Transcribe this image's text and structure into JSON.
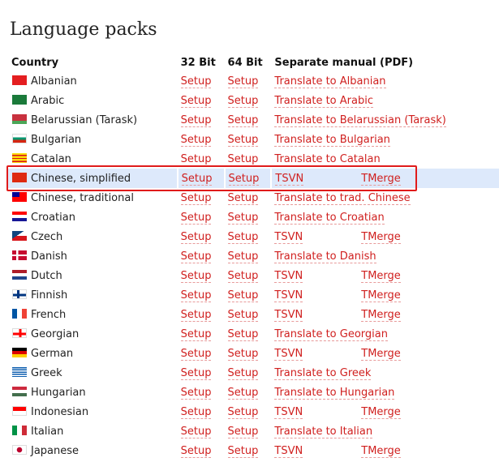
{
  "page": {
    "title": "Language packs"
  },
  "table": {
    "headers": {
      "country": "Country",
      "bit32": "32 Bit",
      "bit64": "64 Bit",
      "manual": "Separate manual (PDF)"
    },
    "rows": [
      {
        "country": "Albanian",
        "flag": "albania-flag-icon",
        "setup32": "Setup",
        "setup64": "Setup",
        "manual": "Translate to Albanian",
        "tmerge": ""
      },
      {
        "country": "Arabic",
        "flag": "saudi-arabia-flag-icon",
        "setup32": "Setup",
        "setup64": "Setup",
        "manual": "Translate to Arabic",
        "tmerge": ""
      },
      {
        "country": "Belarussian (Tarask)",
        "flag": "belarus-flag-icon",
        "setup32": "Setup",
        "setup64": "Setup",
        "manual": "Translate to Belarussian (Tarask)",
        "tmerge": ""
      },
      {
        "country": "Bulgarian",
        "flag": "bulgaria-flag-icon",
        "setup32": "Setup",
        "setup64": "Setup",
        "manual": "Translate to Bulgarian",
        "tmerge": ""
      },
      {
        "country": "Catalan",
        "flag": "catalonia-flag-icon",
        "setup32": "Setup",
        "setup64": "Setup",
        "manual": "Translate to Catalan",
        "tmerge": ""
      },
      {
        "country": "Chinese, simplified",
        "flag": "china-flag-icon",
        "setup32": "Setup",
        "setup64": "Setup",
        "manual": "TSVN",
        "tmerge": "TMerge",
        "highlighted": true
      },
      {
        "country": "Chinese, traditional",
        "flag": "taiwan-flag-icon",
        "setup32": "Setup",
        "setup64": "Setup",
        "manual": "Translate to trad. Chinese",
        "tmerge": ""
      },
      {
        "country": "Croatian",
        "flag": "croatia-flag-icon",
        "setup32": "Setup",
        "setup64": "Setup",
        "manual": "Translate to Croatian",
        "tmerge": ""
      },
      {
        "country": "Czech",
        "flag": "czech-flag-icon",
        "setup32": "Setup",
        "setup64": "Setup",
        "manual": "TSVN",
        "tmerge": "TMerge"
      },
      {
        "country": "Danish",
        "flag": "denmark-flag-icon",
        "setup32": "Setup",
        "setup64": "Setup",
        "manual": "Translate to Danish",
        "tmerge": ""
      },
      {
        "country": "Dutch",
        "flag": "netherlands-flag-icon",
        "setup32": "Setup",
        "setup64": "Setup",
        "manual": "TSVN",
        "tmerge": "TMerge"
      },
      {
        "country": "Finnish",
        "flag": "finland-flag-icon",
        "setup32": "Setup",
        "setup64": "Setup",
        "manual": "TSVN",
        "tmerge": "TMerge"
      },
      {
        "country": "French",
        "flag": "france-flag-icon",
        "setup32": "Setup",
        "setup64": "Setup",
        "manual": "TSVN",
        "tmerge": "TMerge"
      },
      {
        "country": "Georgian",
        "flag": "georgia-flag-icon",
        "setup32": "Setup",
        "setup64": "Setup",
        "manual": "Translate to Georgian",
        "tmerge": ""
      },
      {
        "country": "German",
        "flag": "germany-flag-icon",
        "setup32": "Setup",
        "setup64": "Setup",
        "manual": "TSVN",
        "tmerge": "TMerge"
      },
      {
        "country": "Greek",
        "flag": "greece-flag-icon",
        "setup32": "Setup",
        "setup64": "Setup",
        "manual": "Translate to Greek",
        "tmerge": ""
      },
      {
        "country": "Hungarian",
        "flag": "hungary-flag-icon",
        "setup32": "Setup",
        "setup64": "Setup",
        "manual": "Translate to Hungarian",
        "tmerge": ""
      },
      {
        "country": "Indonesian",
        "flag": "indonesia-flag-icon",
        "setup32": "Setup",
        "setup64": "Setup",
        "manual": "TSVN",
        "tmerge": "TMerge"
      },
      {
        "country": "Italian",
        "flag": "italy-flag-icon",
        "setup32": "Setup",
        "setup64": "Setup",
        "manual": "Translate to Italian",
        "tmerge": ""
      },
      {
        "country": "Japanese",
        "flag": "japan-flag-icon",
        "setup32": "Setup",
        "setup64": "Setup",
        "manual": "TSVN",
        "tmerge": "TMerge"
      }
    ]
  },
  "colors": {
    "link": "#d0201f",
    "highlight_row": "#dde9fb",
    "selection_box": "#e01b1b"
  }
}
